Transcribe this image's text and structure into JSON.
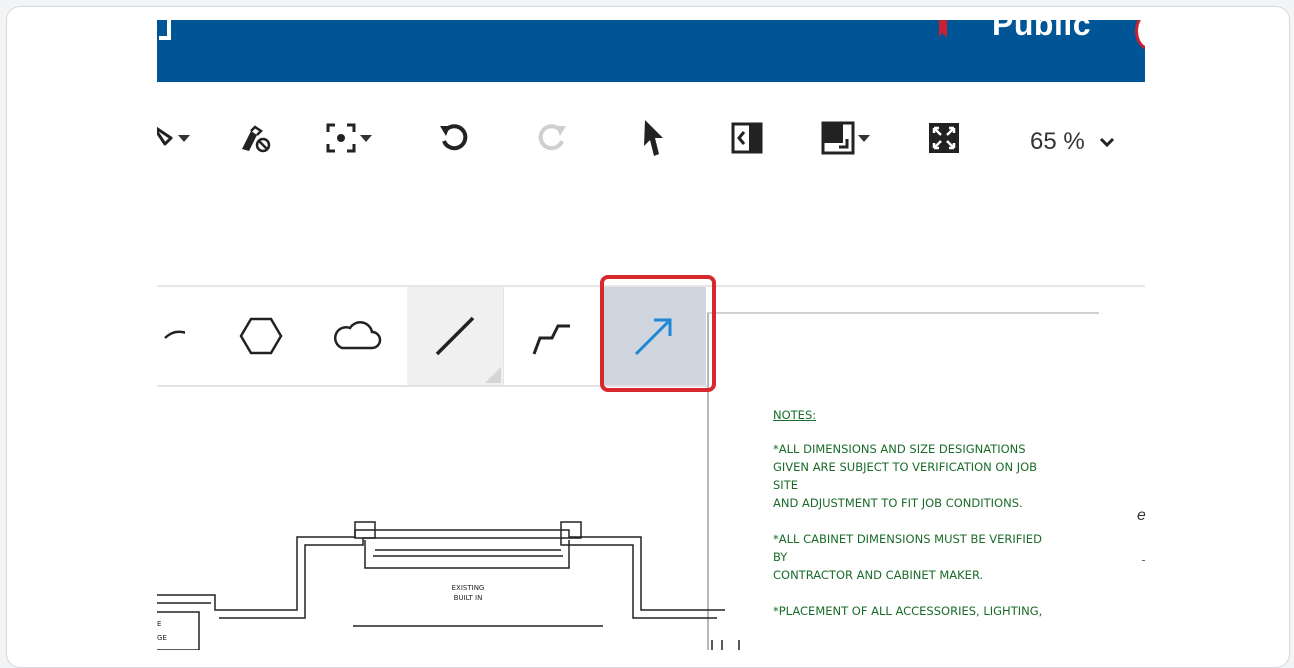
{
  "header": {
    "public_label": "Public"
  },
  "toolbar": {
    "zoom_value": "65 %",
    "buttons": [
      "pen-dropdown",
      "eraser",
      "focus-dropdown",
      "undo",
      "redo",
      "select",
      "panel-collapse",
      "layout-dropdown",
      "fit-screen"
    ]
  },
  "palette": {
    "tools": [
      "arc",
      "hexagon",
      "cloud",
      "line",
      "polyline",
      "arrow"
    ],
    "selected_tool": "arrow",
    "arrow_color": "#1e88d6"
  },
  "drawing": {
    "existing_label_line1": "EXISTING",
    "existing_label_line2": "BUILT IN",
    "left_label_top": "E",
    "left_label_bottom": "GE"
  },
  "notes": {
    "title": "NOTES:",
    "item1_line1": "*ALL DIMENSIONS AND SIZE DESIGNATIONS",
    "item1_line2": "GIVEN ARE SUBJECT TO VERIFICATION ON JOB",
    "item1_line3": "SITE",
    "item1_line4": "AND ADJUSTMENT TO FIT JOB CONDITIONS.",
    "item2_line1": "*ALL CABINET DIMENSIONS MUST BE VERIFIED",
    "item2_line2": "BY",
    "item2_line3": "CONTRACTOR AND CABINET MAKER.",
    "item3_line1": "*PLACEMENT OF ALL ACCESSORIES, LIGHTING,"
  },
  "colors": {
    "header_blue": "#005596",
    "highlight_red": "#d7282e",
    "notes_green": "#1a6b2a"
  }
}
